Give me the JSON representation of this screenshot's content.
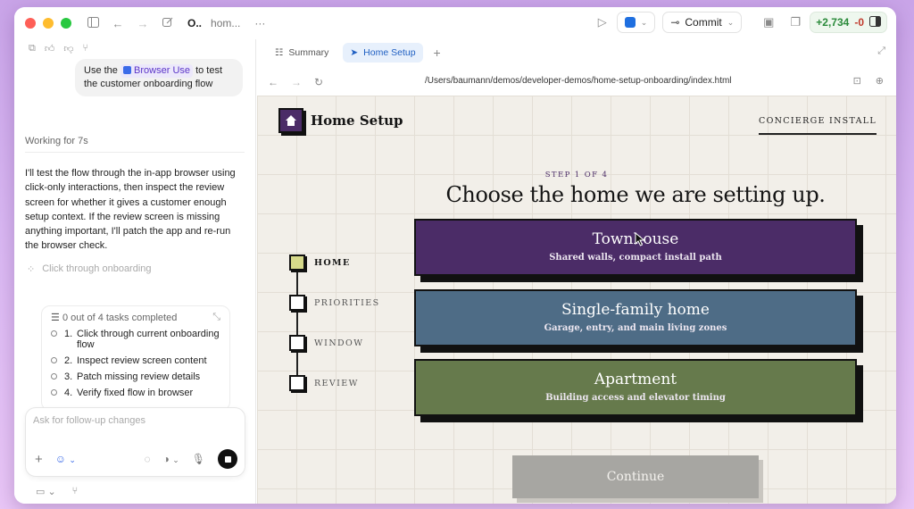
{
  "titlebar": {
    "title": "O..",
    "subtitle": "hom...",
    "more": "···",
    "commit_label": "Commit",
    "additions": "+2,734",
    "deletions": "-0"
  },
  "chat": {
    "user_message_prefix": "Use the",
    "browser_chip": "Browser Use",
    "user_message_suffix": "to test the customer onboarding flow",
    "status": "Working for 7s",
    "response": "I'll test the flow through the in-app browser using click-only interactions, then inspect the review screen for whether it gives a customer enough setup context. If the review screen is missing anything important, I'll patch the app and re-run the browser check.",
    "step": "Click through onboarding",
    "tasks_summary": "0 out of 4 tasks completed",
    "tasks": [
      {
        "num": "1.",
        "label": "Click through current onboarding flow"
      },
      {
        "num": "2.",
        "label": "Inspect review screen content"
      },
      {
        "num": "3.",
        "label": "Patch missing review details"
      },
      {
        "num": "4.",
        "label": "Verify fixed flow in browser"
      }
    ],
    "composer_placeholder": "Ask for follow-up changes"
  },
  "browser": {
    "tabs": [
      {
        "label": "Summary",
        "icon": "list-icon"
      },
      {
        "label": "Home Setup",
        "icon": "cursor-icon"
      }
    ],
    "url": "/Users/baumann/demos/developer-demos/home-setup-onboarding/index.html"
  },
  "page": {
    "brand": "Home Setup",
    "concierge": "CONCIERGE INSTALL",
    "step_label": "STEP 1 OF 4",
    "headline": "Choose the home we are setting up.",
    "rail": [
      {
        "label": "HOME",
        "active": true
      },
      {
        "label": "PRIORITIES",
        "active": false
      },
      {
        "label": "WINDOW",
        "active": false
      },
      {
        "label": "REVIEW",
        "active": false
      }
    ],
    "options": [
      {
        "title": "Townhouse",
        "desc": "Shared walls, compact install path",
        "color": "#4b2c67"
      },
      {
        "title": "Single-family home",
        "desc": "Garage, entry, and main living zones",
        "color": "#4e6c86"
      },
      {
        "title": "Apartment",
        "desc": "Building access and elevator timing",
        "color": "#667a4c"
      }
    ],
    "continue_label": "Continue"
  }
}
